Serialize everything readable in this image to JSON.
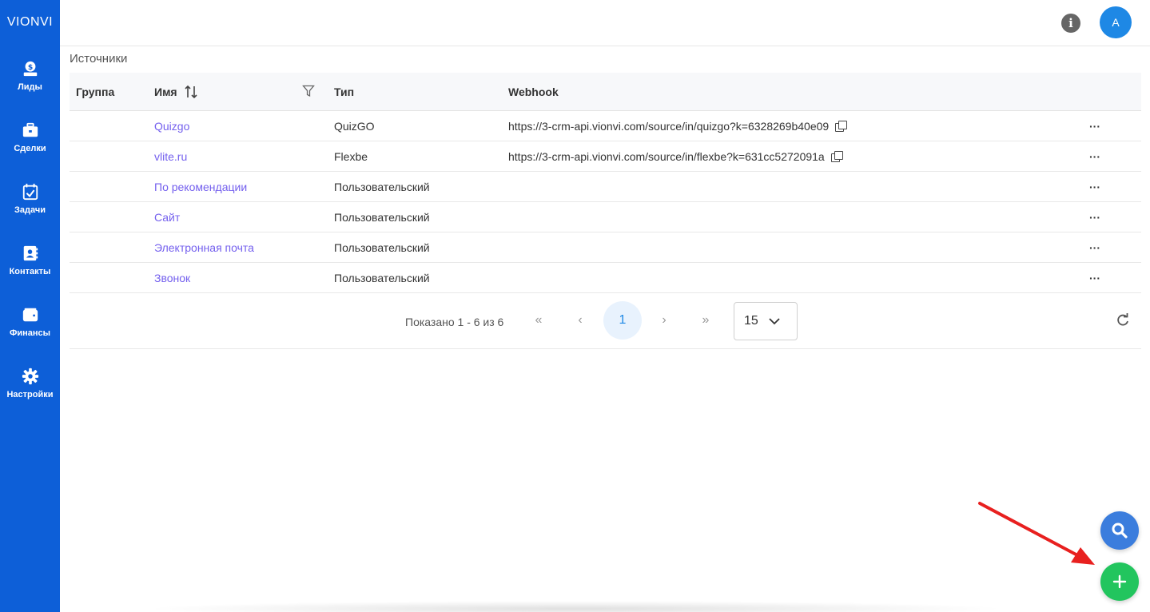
{
  "app": {
    "brand": "VIONVI"
  },
  "sidebar": {
    "items": [
      {
        "label": "Лиды",
        "icon": "money-bag-icon"
      },
      {
        "label": "Сделки",
        "icon": "briefcase-icon"
      },
      {
        "label": "Задачи",
        "icon": "calendar-check-icon"
      },
      {
        "label": "Контакты",
        "icon": "address-book-icon"
      },
      {
        "label": "Финансы",
        "icon": "wallet-icon"
      },
      {
        "label": "Настройки",
        "icon": "gear-icon"
      }
    ]
  },
  "header": {
    "avatar_initial": "A",
    "info_icon": "info-icon"
  },
  "page": {
    "title": "Источники"
  },
  "table": {
    "columns": {
      "group": "Группа",
      "name": "Имя",
      "type": "Тип",
      "webhook": "Webhook"
    },
    "rows": [
      {
        "group": "",
        "name": "Quizgo",
        "type": "QuizGO",
        "webhook": "https://3-crm-api.vionvi.com/source/in/quizgo?k=6328269b40e09"
      },
      {
        "group": "",
        "name": "vlite.ru",
        "type": "Flexbe",
        "webhook": "https://3-crm-api.vionvi.com/source/in/flexbe?k=631cc5272091a"
      },
      {
        "group": "",
        "name": "По рекомендации",
        "type": "Пользовательский",
        "webhook": ""
      },
      {
        "group": "",
        "name": "Сайт",
        "type": "Пользовательский",
        "webhook": ""
      },
      {
        "group": "",
        "name": "Электронная почта",
        "type": "Пользовательский",
        "webhook": ""
      },
      {
        "group": "",
        "name": "Звонок",
        "type": "Пользовательский",
        "webhook": ""
      }
    ]
  },
  "pager": {
    "info": "Показано 1 - 6 из 6",
    "first": "«",
    "prev": "‹",
    "current": "1",
    "next": "›",
    "last": "»",
    "page_size": "15"
  },
  "colors": {
    "sidebar": "#0d5fd8",
    "link": "#7460ee",
    "fab_search": "#3b7ddd",
    "fab_add": "#22c55e",
    "annotation_arrow": "#e8201f"
  }
}
